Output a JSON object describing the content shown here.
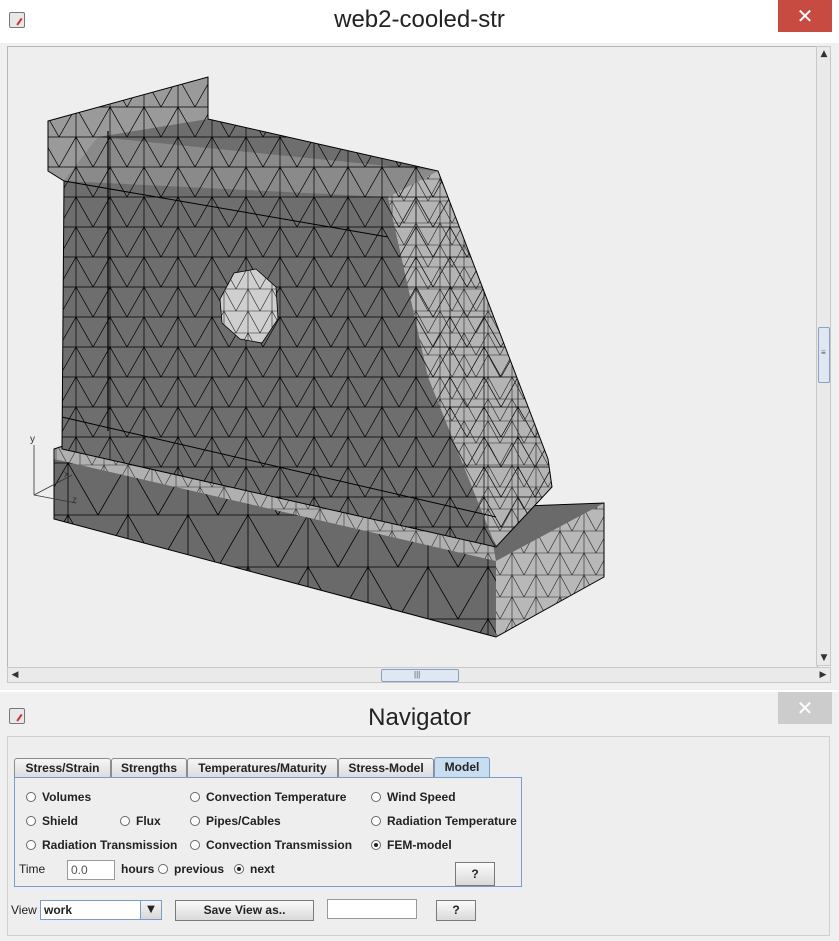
{
  "viewer": {
    "title": "web2-cooled-str",
    "close_glyph": "✕",
    "axes": {
      "y": "y",
      "x": "x",
      "z": "z"
    },
    "scroll": {
      "up": "▲",
      "down": "▼",
      "left": "◀",
      "right": "▶",
      "grip_v": "≡",
      "grip_h": "|||"
    }
  },
  "navigator": {
    "title": "Navigator",
    "close_glyph": "✕",
    "tabs": [
      {
        "label": "Stress/Strain",
        "active": false
      },
      {
        "label": "Strengths",
        "active": false
      },
      {
        "label": "Temperatures/Maturity",
        "active": false
      },
      {
        "label": "Stress-Model",
        "active": false
      },
      {
        "label": "Model",
        "active": true
      }
    ],
    "options": {
      "volumes": "Volumes",
      "convection_temperature": "Convection Temperature",
      "wind_speed": "Wind Speed",
      "shield": "Shield",
      "flux": "Flux",
      "pipes_cables": "Pipes/Cables",
      "radiation_temperature": "Radiation Temperature",
      "radiation_transmission": "Radiation Transmission",
      "convection_transmission": "Convection Transmission",
      "fem_model": "FEM-model"
    },
    "selected_option": "FEM-model",
    "time": {
      "label": "Time",
      "value": "0.0",
      "unit": "hours",
      "previous": "previous",
      "next": "next",
      "selected": "next"
    },
    "help_label": "?",
    "view": {
      "label": "View",
      "selected": "work",
      "dropdown_glyph": "▼",
      "save_label": "Save View as..",
      "name_value": "",
      "help_label": "?"
    }
  },
  "colors": {
    "mesh_face": "#6e6e6e",
    "mesh_light": "#b4b4b4",
    "edge": "#000000",
    "close_active": "#c74b40",
    "tab_active": "#c9ddf1"
  }
}
